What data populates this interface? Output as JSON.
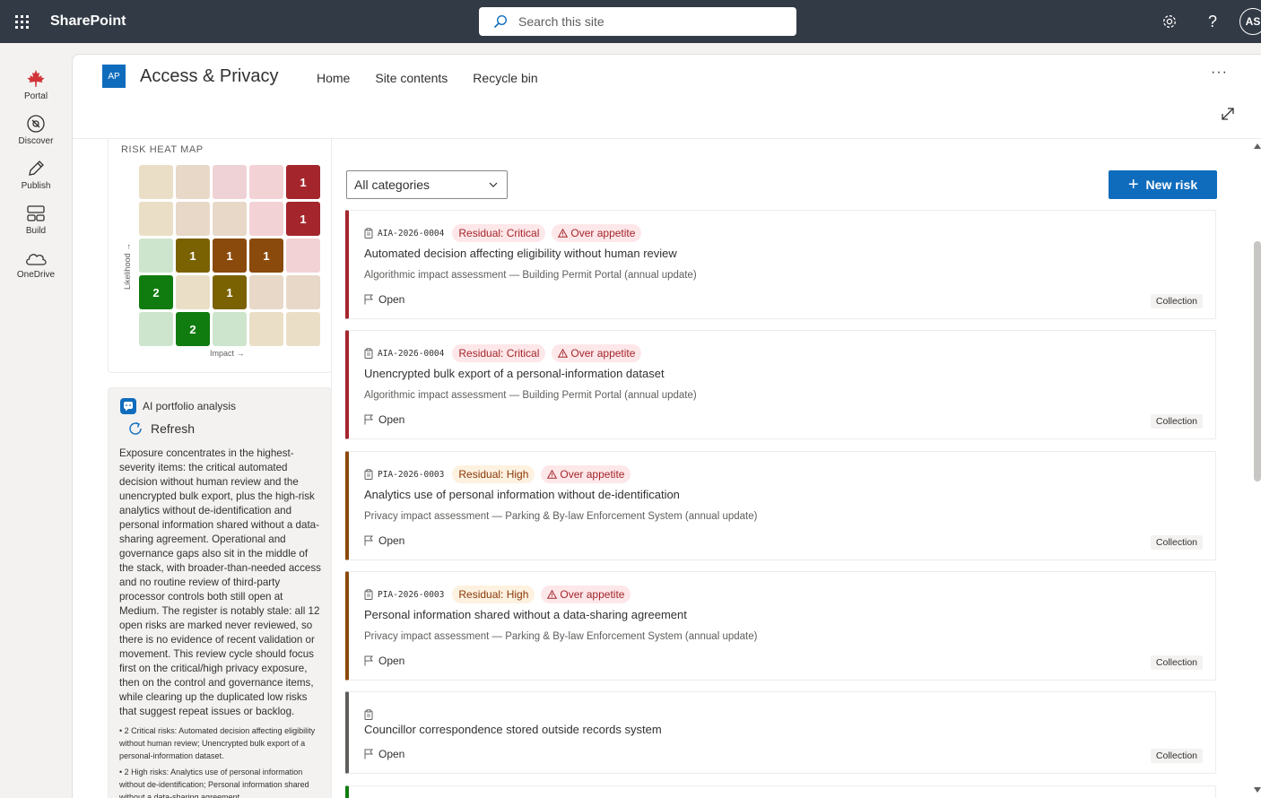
{
  "suite": {
    "brand": "SharePoint",
    "search_placeholder": "Search this site",
    "avatar_initials": "AS"
  },
  "appbar": {
    "items": [
      {
        "label": "Portal",
        "icon": "maple-leaf-icon",
        "color": "#d13438"
      },
      {
        "label": "Discover",
        "icon": "compass-icon"
      },
      {
        "label": "Publish",
        "icon": "pen-icon"
      },
      {
        "label": "Build",
        "icon": "layout-icon"
      },
      {
        "label": "OneDrive",
        "icon": "cloud-icon"
      }
    ]
  },
  "site": {
    "logo": "AP",
    "title": "Access & Privacy",
    "nav": [
      "Home",
      "Site contents",
      "Recycle bin"
    ],
    "more": "···"
  },
  "heatmap": {
    "title": "RISK HEAT MAP",
    "y_label": "Likelihood →",
    "x_label": "Impact →",
    "cells": [
      [
        {
          "v": "",
          "c": "#eadfc6"
        },
        {
          "v": "",
          "c": "#e7d8c8"
        },
        {
          "v": "",
          "c": "#efd2d5"
        },
        {
          "v": "",
          "c": "#f3d2d6"
        },
        {
          "v": "1",
          "c": "#a4262c"
        }
      ],
      [
        {
          "v": "",
          "c": "#eadfc6"
        },
        {
          "v": "",
          "c": "#e7d8c8"
        },
        {
          "v": "",
          "c": "#e7d8c8"
        },
        {
          "v": "",
          "c": "#f3d2d6"
        },
        {
          "v": "1",
          "c": "#a4262c"
        }
      ],
      [
        {
          "v": "",
          "c": "#cde5cc"
        },
        {
          "v": "1",
          "c": "#7a6202"
        },
        {
          "v": "1",
          "c": "#8a4a0c"
        },
        {
          "v": "1",
          "c": "#8a4a0c"
        },
        {
          "v": "",
          "c": "#f3d2d6"
        }
      ],
      [
        {
          "v": "2",
          "c": "#107c10"
        },
        {
          "v": "",
          "c": "#eadfc6"
        },
        {
          "v": "1",
          "c": "#7a6202"
        },
        {
          "v": "",
          "c": "#e7d8c8"
        },
        {
          "v": "",
          "c": "#e7d8c8"
        }
      ],
      [
        {
          "v": "",
          "c": "#cde5cc"
        },
        {
          "v": "2",
          "c": "#107c10"
        },
        {
          "v": "",
          "c": "#cde5cc"
        },
        {
          "v": "",
          "c": "#eadfc6"
        },
        {
          "v": "",
          "c": "#eadfc6"
        }
      ]
    ]
  },
  "ai": {
    "title": "AI portfolio analysis",
    "refresh": "Refresh",
    "body": "Exposure concentrates in the highest-severity items: the critical automated decision without human review and the unencrypted bulk export, plus the high-risk analytics without de-identification and personal information shared without a data-sharing agreement. Operational and governance gaps also sit in the middle of the stack, with broader-than-needed access and no routine review of third-party processor controls both still open at Medium. The register is notably stale: all 12 open risks are marked never reviewed, so there is no evidence of recent validation or movement. This review cycle should focus first on the critical/high privacy exposure, then on the control and governance items, while clearing up the duplicated low risks that suggest repeat issues or backlog.",
    "bullets": [
      "• 2 Critical risks: Automated decision affecting eligibility without human review; Unencrypted bulk export of a personal-information dataset.",
      "• 2 High risks: Analytics use of personal information without de-identification; Personal information shared without a data-sharing agreement."
    ]
  },
  "toolbar": {
    "category": "All categories",
    "new_risk": "New risk"
  },
  "risks": [
    {
      "code": "AIA-2026-0004",
      "residual": "Residual: Critical",
      "level": "critical",
      "appetite": "Over appetite",
      "title": "Automated decision affecting eligibility without human review",
      "subtitle": "Algorithmic impact assessment — Building Permit Portal (annual update)",
      "status": "Open",
      "tag": "Collection",
      "accent": "#a4262c"
    },
    {
      "code": "AIA-2026-0004",
      "residual": "Residual: Critical",
      "level": "critical",
      "appetite": "Over appetite",
      "title": "Unencrypted bulk export of a personal-information dataset",
      "subtitle": "Algorithmic impact assessment — Building Permit Portal (annual update)",
      "status": "Open",
      "tag": "Collection",
      "accent": "#a4262c"
    },
    {
      "code": "PIA-2026-0003",
      "residual": "Residual: High",
      "level": "high",
      "appetite": "Over appetite",
      "title": "Analytics use of personal information without de-identification",
      "subtitle": "Privacy impact assessment — Parking & By-law Enforcement System (annual update)",
      "status": "Open",
      "tag": "Collection",
      "accent": "#8a4a0c"
    },
    {
      "code": "PIA-2026-0003",
      "residual": "Residual: High",
      "level": "high",
      "appetite": "Over appetite",
      "title": "Personal information shared without a data-sharing agreement",
      "subtitle": "Privacy impact assessment — Parking & By-law Enforcement System (annual update)",
      "status": "Open",
      "tag": "Collection",
      "accent": "#8a4a0c"
    },
    {
      "code": "",
      "residual": "",
      "level": "",
      "appetite": "",
      "title": "Councillor correspondence stored outside records system",
      "subtitle": "",
      "status": "Open",
      "tag": "Collection",
      "accent": "#605e5c"
    }
  ]
}
